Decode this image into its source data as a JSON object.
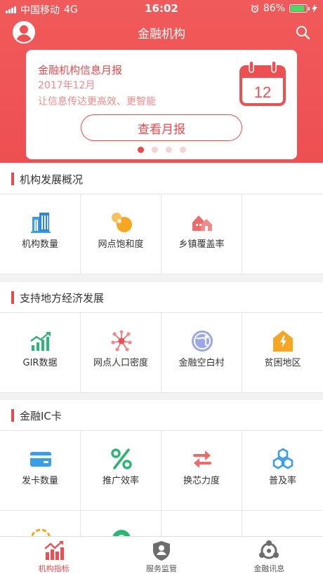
{
  "status_bar": {
    "carrier": "中国移动",
    "network": "4G",
    "time": "16:02",
    "battery": "86%"
  },
  "nav": {
    "title": "金融机构"
  },
  "banner": {
    "title": "金融机构信息月报",
    "date": "2017年12月",
    "slogan": "让信息传达更高效、更智能",
    "calendar_day": "12",
    "button": "查看月报",
    "active_dot": 0
  },
  "sections": [
    {
      "title": "机构发展概况",
      "items": [
        {
          "label": "机构数量",
          "icon": "building-icon"
        },
        {
          "label": "网点饱和度",
          "icon": "bubbles-icon"
        },
        {
          "label": "乡镇覆盖率",
          "icon": "houses-icon"
        },
        {
          "label": "",
          "icon": ""
        }
      ]
    },
    {
      "title": "支持地方经济发展",
      "items": [
        {
          "label": "GIR数据",
          "icon": "growth-chart-icon"
        },
        {
          "label": "网点人口密度",
          "icon": "network-icon"
        },
        {
          "label": "金融空白村",
          "icon": "globe-icon"
        },
        {
          "label": "贫困地区",
          "icon": "poverty-area-icon"
        }
      ]
    },
    {
      "title": "金融IC卡",
      "items": [
        {
          "label": "发卡数量",
          "icon": "card-icon"
        },
        {
          "label": "推广效率",
          "icon": "percent-icon"
        },
        {
          "label": "换芯力度",
          "icon": "swap-icon"
        },
        {
          "label": "普及率",
          "icon": "hexagons-icon"
        }
      ]
    }
  ],
  "tabs": [
    {
      "label": "机构指标",
      "icon": "chart-icon"
    },
    {
      "label": "服务监管",
      "icon": "shield-icon"
    },
    {
      "label": "金融讯息",
      "icon": "nodes-icon"
    }
  ],
  "colors": {
    "brand": "#ee4f52",
    "accent_blue": "#3a9de8",
    "accent_orange": "#f6a623",
    "accent_green": "#2bb673"
  }
}
